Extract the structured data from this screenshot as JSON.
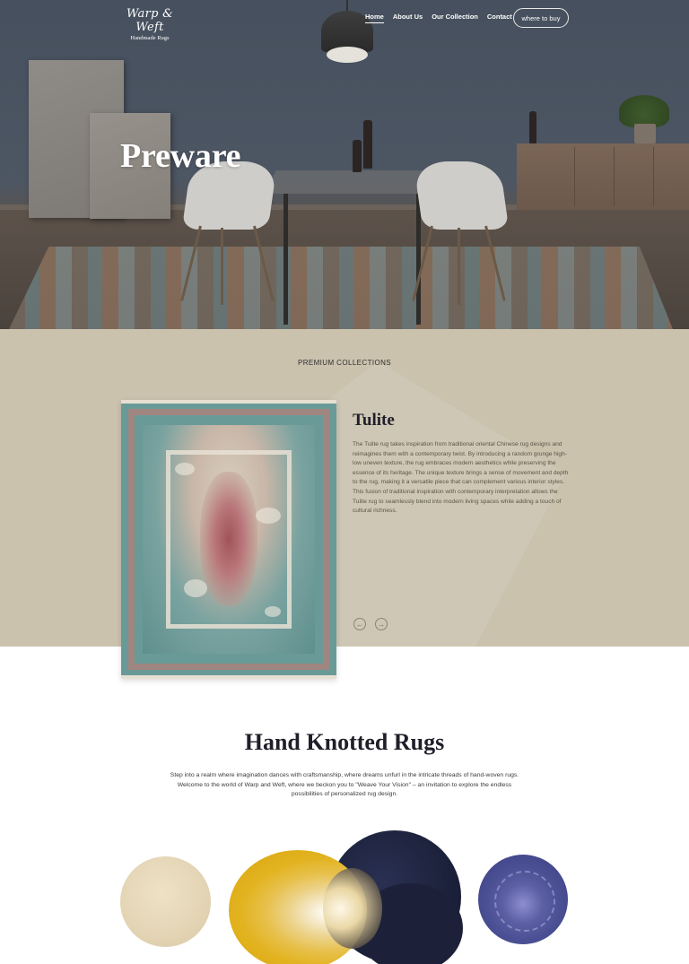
{
  "brand": {
    "name": "Warp & Weft",
    "tagline": "Handmade Rugs"
  },
  "nav": {
    "items": [
      {
        "label": "Home",
        "active": true
      },
      {
        "label": "About Us",
        "active": false
      },
      {
        "label": "Our Collection",
        "active": false
      },
      {
        "label": "Contact",
        "active": false
      }
    ],
    "cta": "where to buy"
  },
  "hero": {
    "title": "Preware"
  },
  "collection": {
    "section_label": "PREMIUM COLLECTIONS",
    "product": {
      "name": "Tulite",
      "description": "The Tulite rug takes inspiration from traditional oriental Chinese rug designs and reimagines them with a contemporary twist. By introducing a random grunge high-low uneven texture, the rug embraces modern aesthetics while preserving the essence of its heritage. The unique texture brings a sense of movement and depth to the rug, making it a versatile piece that can complement various interior styles. This fusion of traditional inspiration with contemporary interpretation allows the Tulite rug to seamlessly blend into modern living spaces while adding a touch of cultural richness."
    },
    "prev_icon": "arrow-left-icon",
    "next_icon": "arrow-right-icon"
  },
  "hand_knotted": {
    "title": "Hand Knotted Rugs",
    "text": "Step into a realm where imagination dances with craftsmanship, where dreams unfurl in the intricate threads of hand-woven rugs. Welcome to the world of Warp and Weft, where we beckon you to \"Weave Your Vision\" – an invitation to explore the endless possibilities of personalized rug design."
  },
  "colors": {
    "collection_bg": "#cbc2ae",
    "title_navy": "#1f1f2a",
    "rug_teal": "#6a9a97",
    "rug_red": "#a0545a"
  }
}
